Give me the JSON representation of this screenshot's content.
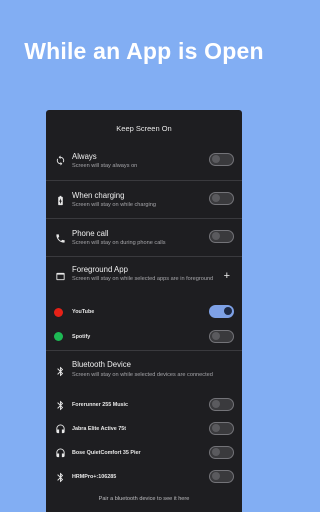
{
  "headline": "While an App is Open",
  "screen_title": "Keep Screen On",
  "rows": {
    "always": {
      "title": "Always",
      "subtitle": "Screen will stay always on",
      "icon": "sync-icon",
      "on": false
    },
    "charging": {
      "title": "When charging",
      "subtitle": "Screen will stay on while charging",
      "icon": "battery-charging-icon",
      "on": false
    },
    "phone_call": {
      "title": "Phone call",
      "subtitle": "Screen will stay on during phone calls",
      "icon": "phone-icon",
      "on": false
    },
    "foreground": {
      "title": "Foreground App",
      "subtitle": "Screen will stay on while selected apps are in foreground",
      "icon": "window-icon",
      "action": "+"
    },
    "bluetooth": {
      "title": "Bluetooth Device",
      "subtitle": "Screen will stay on while selected devices are connected",
      "icon": "bluetooth-icon"
    }
  },
  "apps": [
    {
      "name": "YouTube",
      "color": "#e62117",
      "on": true
    },
    {
      "name": "Spotify",
      "color": "#1db954",
      "on": false
    }
  ],
  "devices": [
    {
      "name": "Forerunner 255 Music",
      "icon": "bluetooth-icon",
      "on": false
    },
    {
      "name": "Jabra Elite Active 75t",
      "icon": "headphones-icon",
      "on": false
    },
    {
      "name": "Bose QuietComfort 35 Pier",
      "icon": "headphones-icon",
      "on": false
    },
    {
      "name": "HRMPro+:106285",
      "icon": "bluetooth-icon",
      "on": false
    }
  ],
  "footer": "Pair a bluetooth device to see it here",
  "colors": {
    "background": "#82aef3",
    "panel": "#1e1e21",
    "accent": "#7ea1e6"
  }
}
